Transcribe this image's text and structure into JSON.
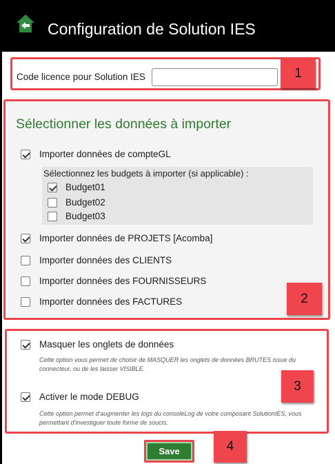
{
  "header": {
    "title": "Configuration de Solution IES",
    "home_icon": "home-back-icon",
    "icon_color": "#2e8b3e"
  },
  "licence": {
    "label": "Code licence pour Solution IES",
    "value": "",
    "placeholder": ""
  },
  "import": {
    "title": "Sélectionner les données à importer",
    "title_color": "#307a2f",
    "compte_gl": {
      "label": "Importer données de compteGL",
      "checked": true
    },
    "budgets": {
      "label": "Sélectionnez les budgets à importer (si applicable) :",
      "items": [
        {
          "label": "Budget01",
          "checked": true
        },
        {
          "label": "Budget02",
          "checked": false
        },
        {
          "label": "Budget03",
          "checked": false
        }
      ]
    },
    "projets": {
      "label": "Importer données de PROJETS [Acomba]",
      "checked": true
    },
    "clients": {
      "label": "Importer données des CLIENTS",
      "checked": false
    },
    "fournisseurs": {
      "label": "Importer données des FOURNISSEURS",
      "checked": false
    },
    "factures": {
      "label": "Importer données des FACTURES",
      "checked": false
    }
  },
  "options": {
    "masquer": {
      "label": "Masquer les onglets de données",
      "checked": true,
      "description": "Cette option vous permet de choisir de MASQUER les onglets de données BRUTES issue du connecteur, ou de les laisser VISIBLE."
    },
    "debug": {
      "label": "Activer le mode DEBUG",
      "checked": true,
      "description": "Cette option permet d'augmenter les logs du consoleLog de votre composant SolutionIES, vous permettant d'investiguer toute forme de soucis."
    }
  },
  "save_label": "Save",
  "annotations": [
    "1",
    "2",
    "3",
    "4"
  ],
  "colors": {
    "annotation_red": "#e9464d",
    "save_green": "#2e7d32"
  }
}
